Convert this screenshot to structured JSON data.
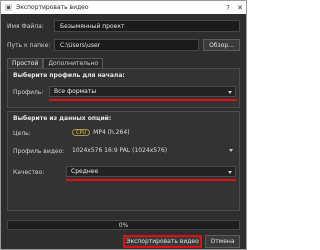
{
  "window": {
    "title": "Экспортировать видео"
  },
  "file": {
    "name_label": "Имя Файла:",
    "name_value": "Безымянный проект"
  },
  "folder": {
    "path_label": "Путь к папке:",
    "path_value": "C:\\Users\\user",
    "browse_label": "Обзор..."
  },
  "tabs": [
    {
      "label": "Простой"
    },
    {
      "label": "Дополнительно"
    }
  ],
  "profile_section": {
    "title": "Выберите профиль для начала:",
    "profile_label": "Профиль:",
    "profile_value": "Все форматы"
  },
  "options_section": {
    "title": "Выберите из данных опций:",
    "target_label": "Цель:",
    "target_badge": "CPU",
    "target_value": "MP4 (h.264)",
    "video_profile_label": "Профиль видео:",
    "video_profile_value": "1024x576 16:9 PAL (1024x576)",
    "quality_label": "Качество:",
    "quality_value": "Среднее"
  },
  "progress": {
    "value": 0,
    "text": "0%"
  },
  "actions": {
    "export_label": "Экспортировать видео",
    "cancel_label": "Отмена"
  },
  "colors": {
    "accent": "#e00f16",
    "window_bg": "#2e2e2e",
    "field_bg": "#1b1b1b"
  },
  "icons": {
    "app": "app-icon",
    "close": "close-icon",
    "dropdown": "chevron-down-icon"
  }
}
